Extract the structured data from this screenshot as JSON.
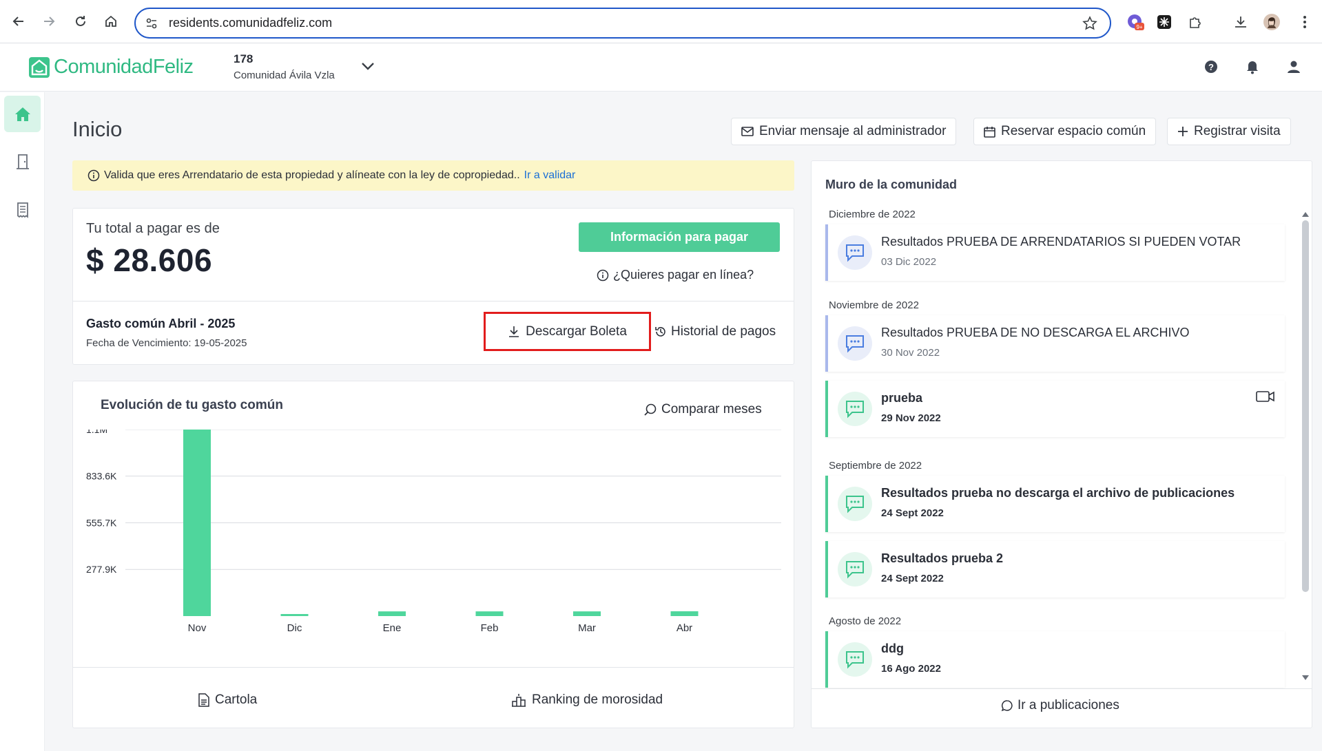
{
  "browser": {
    "url": "residents.comunidadfeliz.com",
    "extension_badge": "9+"
  },
  "app": {
    "logo_text": "ComunidadFeliz",
    "unit_number": "178",
    "community_name": "Comunidad Ávila Vzla",
    "brand_color": "#4fcc97"
  },
  "page": {
    "title": "Inicio",
    "actions": {
      "message": "Enviar mensaje al administrador",
      "reserve": "Reservar espacio común",
      "visit": "Registrar visita"
    }
  },
  "alert": {
    "text": "Valida que eres Arrendatario de esta propiedad y alíneate con la ley de copropiedad..",
    "link": "Ir a validar"
  },
  "payment": {
    "label": "Tu total a pagar es de",
    "amount": "$ 28.606",
    "pay_button": "Información para pagar",
    "online": "¿Quieres pagar en línea?",
    "period": "Gasto común Abril - 2025",
    "due": "Fecha de Vencimiento: 19-05-2025",
    "download": "Descargar Boleta",
    "history": "Historial de pagos"
  },
  "chart_panel": {
    "title": "Evolución de tu gasto común",
    "compare": "Comparar meses",
    "cartola": "Cartola",
    "ranking": "Ranking de morosidad"
  },
  "chart_data": {
    "type": "bar",
    "categories": [
      "Nov",
      "Dic",
      "Ene",
      "Feb",
      "Mar",
      "Abr"
    ],
    "values": [
      1111000,
      1500,
      28000,
      28000,
      28000,
      28606
    ],
    "yticks": [
      "1.1M",
      "833.6K",
      "555.7K",
      "277.9K"
    ],
    "ytick_values": [
      1111000,
      833600,
      555700,
      277900
    ],
    "ylim": [
      0,
      1111000
    ],
    "grid": true,
    "color": "#4fd69c"
  },
  "wall": {
    "title": "Muro de la comunidad",
    "link": "Ir a publicaciones",
    "groups": [
      {
        "month": "Diciembre de 2022",
        "posts": [
          {
            "title": "Resultados PRUEBA DE ARRENDATARIOS SI PUEDEN VOTAR",
            "date": "03 Dic 2022"
          }
        ]
      },
      {
        "month": "Noviembre de 2022",
        "posts": [
          {
            "title": "Resultados PRUEBA DE NO DESCARGA EL ARCHIVO",
            "date": "30 Nov 2022"
          },
          {
            "title": "prueba",
            "date": "29 Nov 2022"
          }
        ]
      },
      {
        "month": "Septiembre de 2022",
        "posts": [
          {
            "title": "Resultados prueba no descarga el archivo de publicaciones",
            "date": "24 Sept 2022"
          },
          {
            "title": "Resultados prueba 2",
            "date": "24 Sept 2022"
          }
        ]
      },
      {
        "month": "Agosto de 2022",
        "posts": [
          {
            "title": "ddg",
            "date": "16 Ago 2022"
          }
        ]
      }
    ]
  }
}
